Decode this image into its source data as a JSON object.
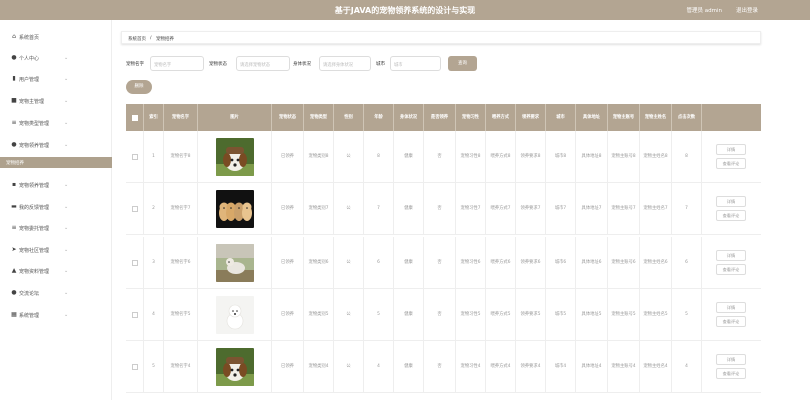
{
  "header": {
    "title": "基于JAVA的宠物领养系统的设计与实现",
    "user": "管理员 admin",
    "logout": "退出登录"
  },
  "sidebar": {
    "items": [
      {
        "label": "系统首页",
        "icon": "home-icon",
        "glyph": "⌂"
      },
      {
        "label": "个人中心",
        "icon": "user-icon",
        "glyph": "●"
      },
      {
        "label": "用户管理",
        "icon": "bar-chart-icon",
        "glyph": "▮"
      },
      {
        "label": "宠物主管理",
        "icon": "folder-icon",
        "glyph": "■"
      },
      {
        "label": "宠物类型管理",
        "icon": "sliders-icon",
        "glyph": "≡"
      },
      {
        "label": "宠物领养管理",
        "icon": "paw-icon",
        "glyph": "●"
      },
      {
        "label": "宠物领养管理",
        "icon": "grid-icon",
        "glyph": "▪"
      },
      {
        "label": "我的反馈管理",
        "icon": "message-icon",
        "glyph": "▬"
      },
      {
        "label": "宠物委托管理",
        "icon": "list-icon",
        "glyph": "≡"
      },
      {
        "label": "宠物社区管理",
        "icon": "send-icon",
        "glyph": "➤"
      },
      {
        "label": "宠物资料管理",
        "icon": "chart-icon",
        "glyph": "▲"
      },
      {
        "label": "交流论坛",
        "icon": "location-icon",
        "glyph": "●"
      },
      {
        "label": "系统管理",
        "icon": "settings-icon",
        "glyph": "▦"
      }
    ],
    "active_sub": "宠物招养"
  },
  "breadcrumb": {
    "home": "系统首页",
    "sep": "/",
    "current": "宠物招养"
  },
  "search": {
    "name_label": "宠物名字",
    "name_placeholder": "宠物名字",
    "status_label": "宠物状态",
    "status_placeholder": "请选择宠物状态",
    "health_label": "身体状况",
    "health_placeholder": "请选择身体状况",
    "city_label": "城市",
    "city_placeholder": "城市",
    "button": "查询"
  },
  "delete_button": "删除",
  "table": {
    "headers": [
      "索引",
      "宠物名字",
      "图片",
      "宠物状态",
      "宠物类型",
      "性别",
      "年龄",
      "身体状况",
      "是否领养",
      "宠物习性",
      "喂养方式",
      "领养要求",
      "城市",
      "具体地址",
      "宠物主账号",
      "宠物主姓名",
      "点击次数"
    ],
    "actions": {
      "detail": "详情",
      "review": "查看评论"
    },
    "rows": [
      {
        "index": "1",
        "name": "宠物名字8",
        "img": "puppy-hat",
        "status": "已领养",
        "type": "宠物类别8",
        "sex": "公",
        "age": "8",
        "health": "健康",
        "adopted": "否",
        "habit": "宠物习性8",
        "feed": "喂养方式8",
        "req": "领养要求8",
        "city": "城市8",
        "addr": "具体地址8",
        "owner_acc": "宠物主账号8",
        "owner_name": "宠物主姓名8",
        "clicks": "8"
      },
      {
        "index": "2",
        "name": "宠物名字7",
        "img": "puppies",
        "status": "已领养",
        "type": "宠物类别7",
        "sex": "公",
        "age": "7",
        "health": "健康",
        "adopted": "否",
        "habit": "宠物习性7",
        "feed": "喂养方式7",
        "req": "领养要求7",
        "city": "城市7",
        "addr": "具体地址7",
        "owner_acc": "宠物主账号7",
        "owner_name": "宠物主姓名7",
        "clicks": "7"
      },
      {
        "index": "3",
        "name": "宠物名字6",
        "img": "dog-outdoor",
        "status": "已领养",
        "type": "宠物类别6",
        "sex": "公",
        "age": "6",
        "health": "健康",
        "adopted": "否",
        "habit": "宠物习性6",
        "feed": "喂养方式6",
        "req": "领养要求6",
        "city": "城市6",
        "addr": "具体地址6",
        "owner_acc": "宠物主账号6",
        "owner_name": "宠物主姓名6",
        "clicks": "6"
      },
      {
        "index": "4",
        "name": "宠物名字5",
        "img": "white-puppy",
        "status": "已领养",
        "type": "宠物类别5",
        "sex": "公",
        "age": "5",
        "health": "健康",
        "adopted": "否",
        "habit": "宠物习性5",
        "feed": "喂养方式5",
        "req": "领养要求5",
        "city": "城市5",
        "addr": "具体地址5",
        "owner_acc": "宠物主账号5",
        "owner_name": "宠物主姓名5",
        "clicks": "5"
      },
      {
        "index": "5",
        "name": "宠物名字4",
        "img": "puppy-hat",
        "status": "已领养",
        "type": "宠物类别4",
        "sex": "公",
        "age": "4",
        "health": "健康",
        "adopted": "否",
        "habit": "宠物习性4",
        "feed": "喂养方式4",
        "req": "领养要求4",
        "city": "城市4",
        "addr": "具体地址4",
        "owner_acc": "宠物主账号4",
        "owner_name": "宠物主姓名4",
        "clicks": "4"
      }
    ]
  },
  "colors": {
    "accent": "#b3a592"
  }
}
